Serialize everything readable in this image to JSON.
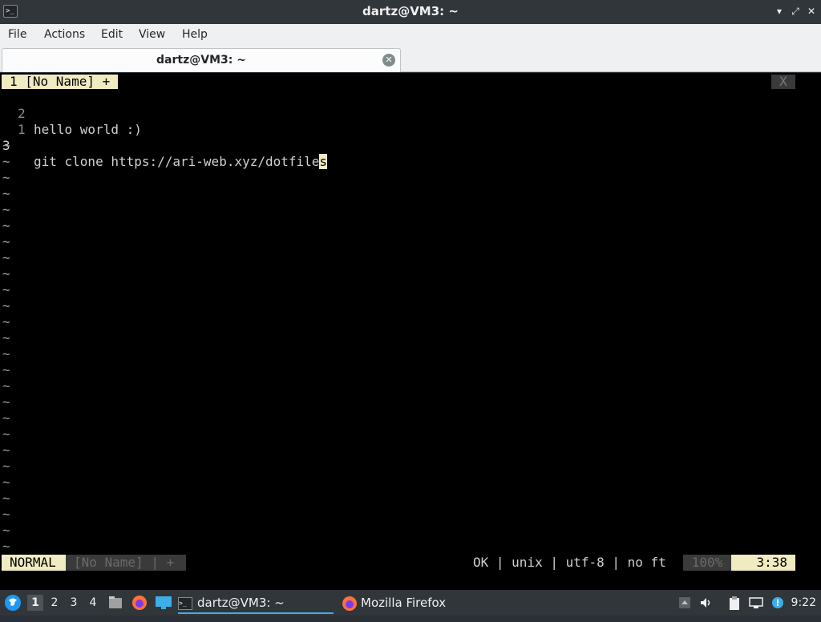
{
  "window": {
    "title": "dartz@VM3: ~",
    "controls": [
      "▾",
      "✕",
      "✕"
    ]
  },
  "menu": {
    "items": [
      "File",
      "Actions",
      "Edit",
      "View",
      "Help"
    ]
  },
  "tabbar": {
    "tab_label": "dartz@VM3: ~",
    "close": "✕"
  },
  "vim": {
    "tab_active": "1 [No Name] +",
    "tab_close": "X",
    "lines": [
      {
        "num": "2",
        "text": "hello world :)"
      },
      {
        "num": "1",
        "text": ""
      },
      {
        "num": "3",
        "text_before_cursor": "git clone https://ari-web.xyz/dotfile",
        "cursor_char": "s"
      }
    ],
    "tilde": "~",
    "status": {
      "mode": "NORMAL",
      "name": "[No Name] | +",
      "info": "OK | unix | utf-8 | no ft",
      "percent": "100%",
      "position": "3:38"
    }
  },
  "taskbar": {
    "workspaces": [
      "1",
      "2",
      "3",
      "4"
    ],
    "active_workspace": "1",
    "tasks": [
      {
        "label": "dartz@VM3: ~",
        "icon": "terminal-icon"
      },
      {
        "label": "Mozilla Firefox",
        "icon": "firefox-icon"
      }
    ],
    "clock": "9:22"
  }
}
